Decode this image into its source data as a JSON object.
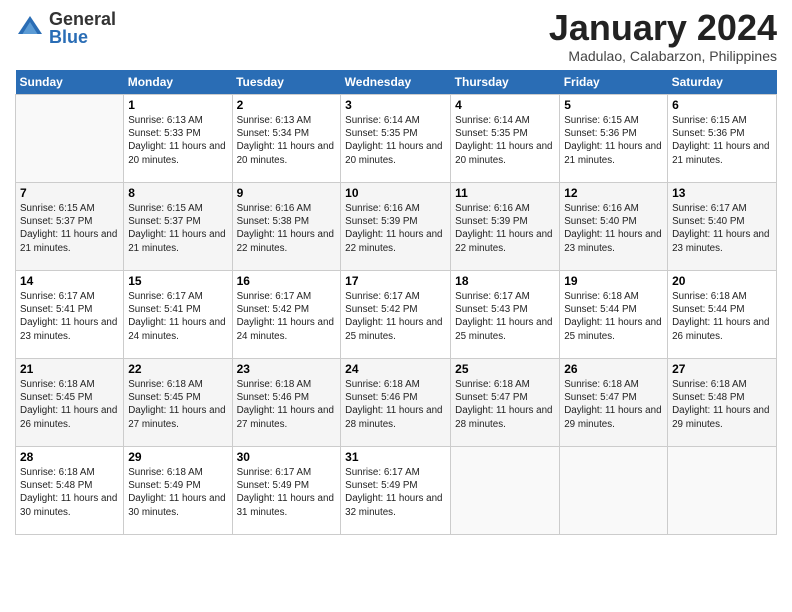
{
  "header": {
    "logo_general": "General",
    "logo_blue": "Blue",
    "month_title": "January 2024",
    "location": "Madulao, Calabarzon, Philippines"
  },
  "days_of_week": [
    "Sunday",
    "Monday",
    "Tuesday",
    "Wednesday",
    "Thursday",
    "Friday",
    "Saturday"
  ],
  "weeks": [
    [
      {
        "day": "",
        "sunrise": "",
        "sunset": "",
        "daylight": ""
      },
      {
        "day": "1",
        "sunrise": "Sunrise: 6:13 AM",
        "sunset": "Sunset: 5:33 PM",
        "daylight": "Daylight: 11 hours and 20 minutes."
      },
      {
        "day": "2",
        "sunrise": "Sunrise: 6:13 AM",
        "sunset": "Sunset: 5:34 PM",
        "daylight": "Daylight: 11 hours and 20 minutes."
      },
      {
        "day": "3",
        "sunrise": "Sunrise: 6:14 AM",
        "sunset": "Sunset: 5:35 PM",
        "daylight": "Daylight: 11 hours and 20 minutes."
      },
      {
        "day": "4",
        "sunrise": "Sunrise: 6:14 AM",
        "sunset": "Sunset: 5:35 PM",
        "daylight": "Daylight: 11 hours and 20 minutes."
      },
      {
        "day": "5",
        "sunrise": "Sunrise: 6:15 AM",
        "sunset": "Sunset: 5:36 PM",
        "daylight": "Daylight: 11 hours and 21 minutes."
      },
      {
        "day": "6",
        "sunrise": "Sunrise: 6:15 AM",
        "sunset": "Sunset: 5:36 PM",
        "daylight": "Daylight: 11 hours and 21 minutes."
      }
    ],
    [
      {
        "day": "7",
        "sunrise": "Sunrise: 6:15 AM",
        "sunset": "Sunset: 5:37 PM",
        "daylight": "Daylight: 11 hours and 21 minutes."
      },
      {
        "day": "8",
        "sunrise": "Sunrise: 6:15 AM",
        "sunset": "Sunset: 5:37 PM",
        "daylight": "Daylight: 11 hours and 21 minutes."
      },
      {
        "day": "9",
        "sunrise": "Sunrise: 6:16 AM",
        "sunset": "Sunset: 5:38 PM",
        "daylight": "Daylight: 11 hours and 22 minutes."
      },
      {
        "day": "10",
        "sunrise": "Sunrise: 6:16 AM",
        "sunset": "Sunset: 5:39 PM",
        "daylight": "Daylight: 11 hours and 22 minutes."
      },
      {
        "day": "11",
        "sunrise": "Sunrise: 6:16 AM",
        "sunset": "Sunset: 5:39 PM",
        "daylight": "Daylight: 11 hours and 22 minutes."
      },
      {
        "day": "12",
        "sunrise": "Sunrise: 6:16 AM",
        "sunset": "Sunset: 5:40 PM",
        "daylight": "Daylight: 11 hours and 23 minutes."
      },
      {
        "day": "13",
        "sunrise": "Sunrise: 6:17 AM",
        "sunset": "Sunset: 5:40 PM",
        "daylight": "Daylight: 11 hours and 23 minutes."
      }
    ],
    [
      {
        "day": "14",
        "sunrise": "Sunrise: 6:17 AM",
        "sunset": "Sunset: 5:41 PM",
        "daylight": "Daylight: 11 hours and 23 minutes."
      },
      {
        "day": "15",
        "sunrise": "Sunrise: 6:17 AM",
        "sunset": "Sunset: 5:41 PM",
        "daylight": "Daylight: 11 hours and 24 minutes."
      },
      {
        "day": "16",
        "sunrise": "Sunrise: 6:17 AM",
        "sunset": "Sunset: 5:42 PM",
        "daylight": "Daylight: 11 hours and 24 minutes."
      },
      {
        "day": "17",
        "sunrise": "Sunrise: 6:17 AM",
        "sunset": "Sunset: 5:42 PM",
        "daylight": "Daylight: 11 hours and 25 minutes."
      },
      {
        "day": "18",
        "sunrise": "Sunrise: 6:17 AM",
        "sunset": "Sunset: 5:43 PM",
        "daylight": "Daylight: 11 hours and 25 minutes."
      },
      {
        "day": "19",
        "sunrise": "Sunrise: 6:18 AM",
        "sunset": "Sunset: 5:44 PM",
        "daylight": "Daylight: 11 hours and 25 minutes."
      },
      {
        "day": "20",
        "sunrise": "Sunrise: 6:18 AM",
        "sunset": "Sunset: 5:44 PM",
        "daylight": "Daylight: 11 hours and 26 minutes."
      }
    ],
    [
      {
        "day": "21",
        "sunrise": "Sunrise: 6:18 AM",
        "sunset": "Sunset: 5:45 PM",
        "daylight": "Daylight: 11 hours and 26 minutes."
      },
      {
        "day": "22",
        "sunrise": "Sunrise: 6:18 AM",
        "sunset": "Sunset: 5:45 PM",
        "daylight": "Daylight: 11 hours and 27 minutes."
      },
      {
        "day": "23",
        "sunrise": "Sunrise: 6:18 AM",
        "sunset": "Sunset: 5:46 PM",
        "daylight": "Daylight: 11 hours and 27 minutes."
      },
      {
        "day": "24",
        "sunrise": "Sunrise: 6:18 AM",
        "sunset": "Sunset: 5:46 PM",
        "daylight": "Daylight: 11 hours and 28 minutes."
      },
      {
        "day": "25",
        "sunrise": "Sunrise: 6:18 AM",
        "sunset": "Sunset: 5:47 PM",
        "daylight": "Daylight: 11 hours and 28 minutes."
      },
      {
        "day": "26",
        "sunrise": "Sunrise: 6:18 AM",
        "sunset": "Sunset: 5:47 PM",
        "daylight": "Daylight: 11 hours and 29 minutes."
      },
      {
        "day": "27",
        "sunrise": "Sunrise: 6:18 AM",
        "sunset": "Sunset: 5:48 PM",
        "daylight": "Daylight: 11 hours and 29 minutes."
      }
    ],
    [
      {
        "day": "28",
        "sunrise": "Sunrise: 6:18 AM",
        "sunset": "Sunset: 5:48 PM",
        "daylight": "Daylight: 11 hours and 30 minutes."
      },
      {
        "day": "29",
        "sunrise": "Sunrise: 6:18 AM",
        "sunset": "Sunset: 5:49 PM",
        "daylight": "Daylight: 11 hours and 30 minutes."
      },
      {
        "day": "30",
        "sunrise": "Sunrise: 6:17 AM",
        "sunset": "Sunset: 5:49 PM",
        "daylight": "Daylight: 11 hours and 31 minutes."
      },
      {
        "day": "31",
        "sunrise": "Sunrise: 6:17 AM",
        "sunset": "Sunset: 5:49 PM",
        "daylight": "Daylight: 11 hours and 32 minutes."
      },
      {
        "day": "",
        "sunrise": "",
        "sunset": "",
        "daylight": ""
      },
      {
        "day": "",
        "sunrise": "",
        "sunset": "",
        "daylight": ""
      },
      {
        "day": "",
        "sunrise": "",
        "sunset": "",
        "daylight": ""
      }
    ]
  ]
}
